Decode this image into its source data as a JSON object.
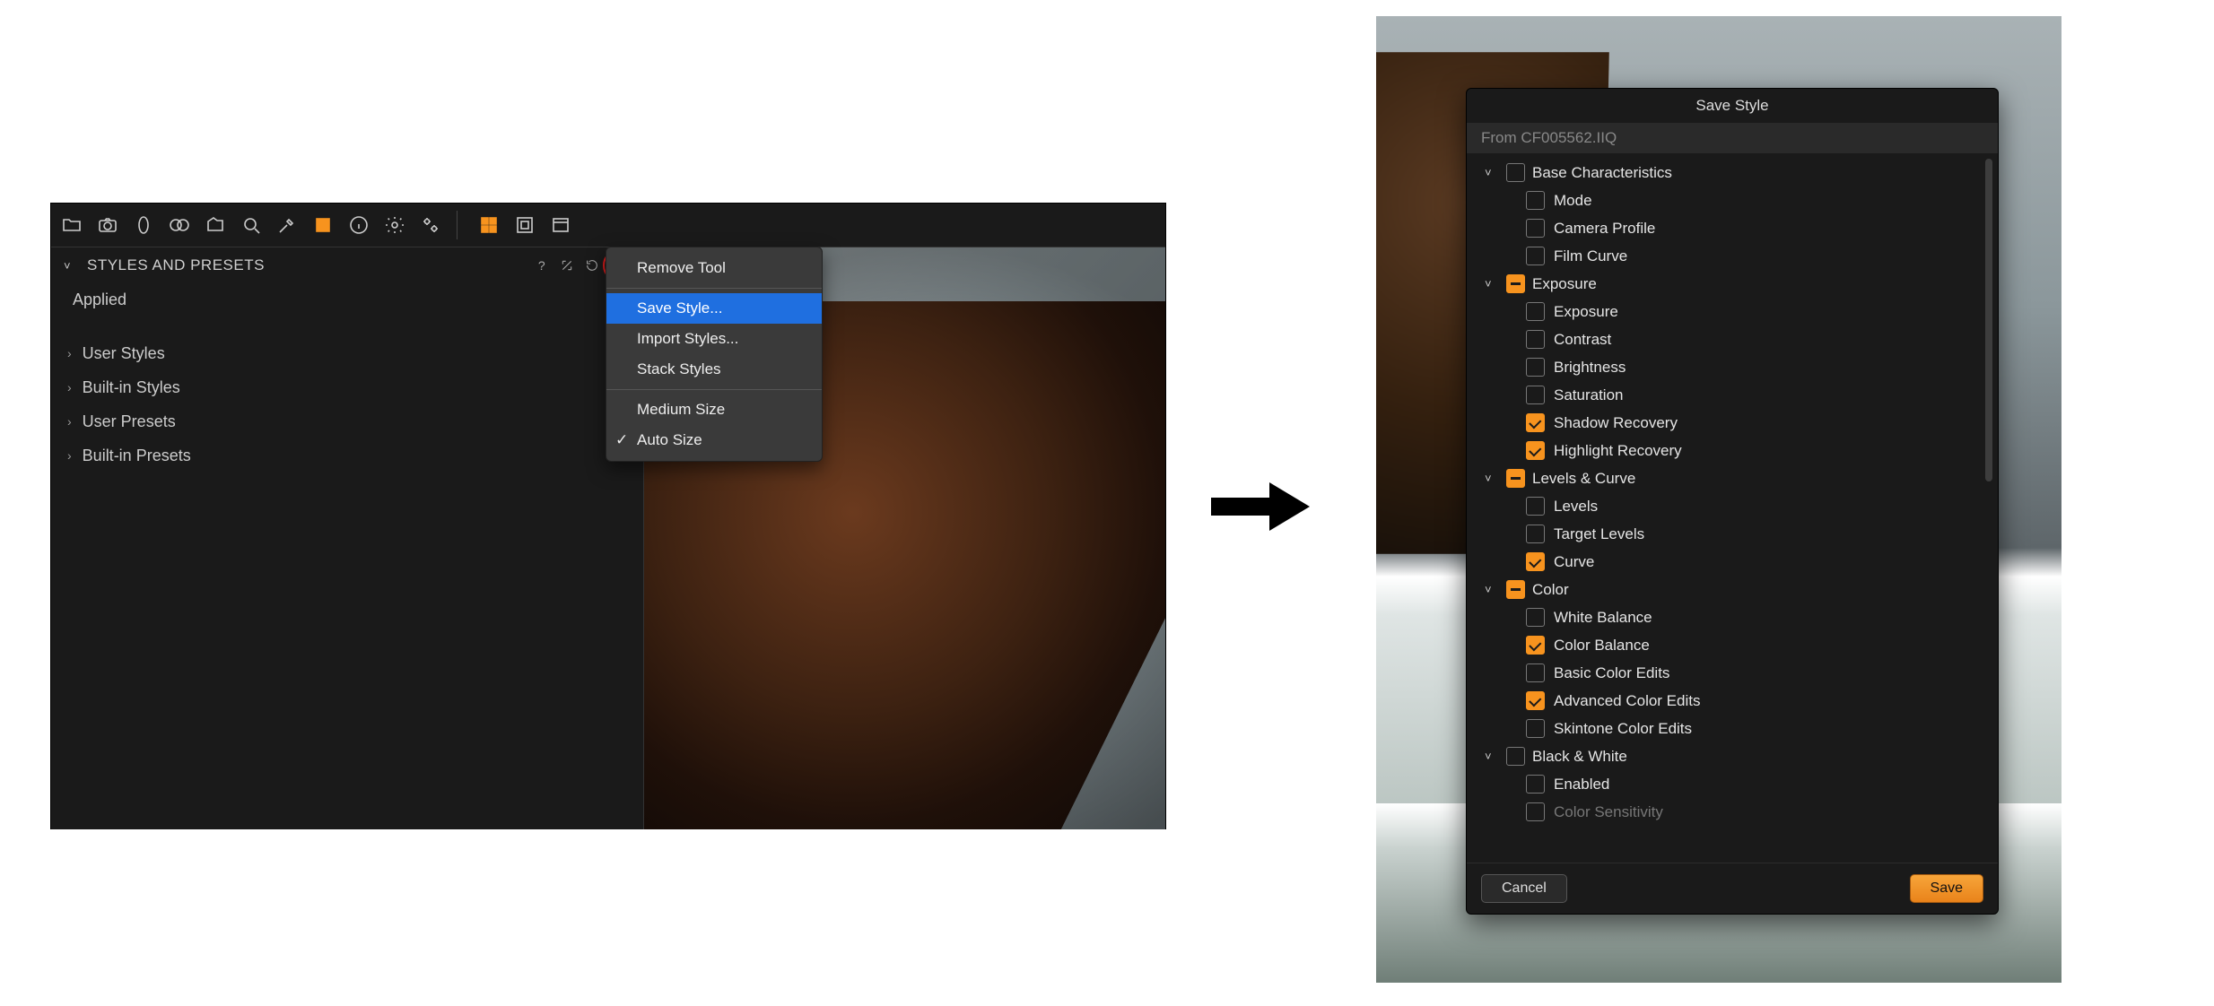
{
  "toolbar": {
    "icons": [
      "folder",
      "camera",
      "lens",
      "color-wheel",
      "export",
      "loupe",
      "eyedropper",
      "annotate",
      "info",
      "gear",
      "gears",
      "grid",
      "crop",
      "window"
    ]
  },
  "panel": {
    "title": "STYLES AND PRESETS",
    "applied": "Applied",
    "rows": [
      "User Styles",
      "Built-in Styles",
      "User Presets",
      "Built-in Presets"
    ]
  },
  "ctx": {
    "items": [
      {
        "label": "Remove Tool",
        "selected": false
      },
      {
        "label": "Save Style...",
        "selected": true
      },
      {
        "label": "Import Styles...",
        "selected": false
      },
      {
        "label": "Stack Styles",
        "selected": false
      },
      {
        "label": "Medium Size",
        "selected": false
      },
      {
        "label": "Auto Size",
        "selected": false,
        "checked": true
      }
    ]
  },
  "dialog": {
    "title": "Save Style",
    "from": "From CF005562.IIQ",
    "groups": [
      {
        "name": "Base Characteristics",
        "state": "off",
        "children": [
          {
            "name": "Mode",
            "state": "off"
          },
          {
            "name": "Camera Profile",
            "state": "off"
          },
          {
            "name": "Film Curve",
            "state": "off"
          }
        ]
      },
      {
        "name": "Exposure",
        "state": "mixed",
        "children": [
          {
            "name": "Exposure",
            "state": "off"
          },
          {
            "name": "Contrast",
            "state": "off"
          },
          {
            "name": "Brightness",
            "state": "off"
          },
          {
            "name": "Saturation",
            "state": "off"
          },
          {
            "name": "Shadow Recovery",
            "state": "on"
          },
          {
            "name": "Highlight Recovery",
            "state": "on"
          }
        ]
      },
      {
        "name": "Levels & Curve",
        "state": "mixed",
        "children": [
          {
            "name": "Levels",
            "state": "off"
          },
          {
            "name": "Target Levels",
            "state": "off"
          },
          {
            "name": "Curve",
            "state": "on"
          }
        ]
      },
      {
        "name": "Color",
        "state": "mixed",
        "children": [
          {
            "name": "White Balance",
            "state": "off"
          },
          {
            "name": "Color Balance",
            "state": "on"
          },
          {
            "name": "Basic Color Edits",
            "state": "off"
          },
          {
            "name": "Advanced Color Edits",
            "state": "on"
          },
          {
            "name": "Skintone Color Edits",
            "state": "off"
          }
        ]
      },
      {
        "name": "Black & White",
        "state": "off",
        "children": [
          {
            "name": "Enabled",
            "state": "off"
          },
          {
            "name": "Color Sensitivity",
            "state": "off",
            "faded": true
          }
        ]
      }
    ],
    "cancel": "Cancel",
    "save": "Save"
  }
}
